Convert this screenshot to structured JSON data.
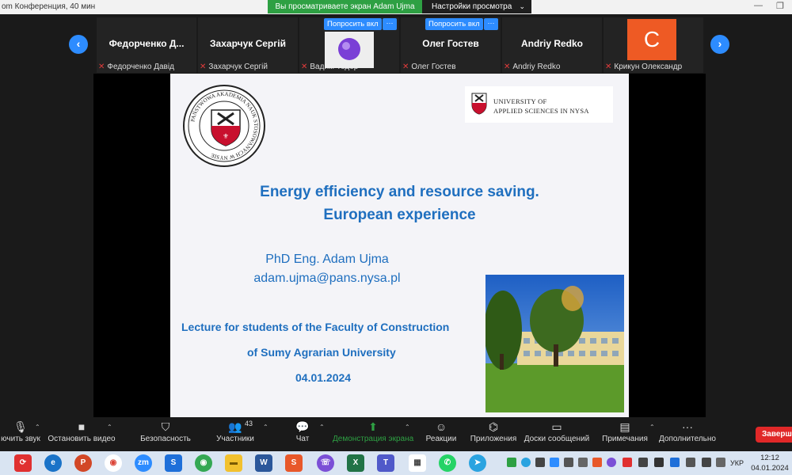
{
  "window": {
    "title": "om Конференция, 40 мин",
    "share_banner": "Вы просматриваете экран Adam Ujma",
    "view_options": "Настройки просмотра"
  },
  "participants": [
    {
      "display": "Федорченко Д...",
      "label": "Федорченко Давід"
    },
    {
      "display": "Захарчук Сергій",
      "label": "Захарчук Сергій"
    },
    {
      "display": "",
      "label": "Вадим Тодор",
      "ask": "Попросить вкл"
    },
    {
      "display": "Олег Гостев",
      "label": "Олег Гостев",
      "ask": "Попросить вкл"
    },
    {
      "display": "Andriy Redko",
      "label": "Andriy Redko"
    },
    {
      "display": "C",
      "label": "Крикун Олександр"
    }
  ],
  "slide": {
    "seal_text": "PAŃSTWOWA AKADEMIA NAUK STOSOWANYCH W NYSIE",
    "uni_line1": "UNIVERSITY OF",
    "uni_line2": "APPLIED SCIENCES IN NYSA",
    "title_line1": "Energy efficiency and resource saving.",
    "title_line2": "European experience",
    "author": "PhD Eng. Adam Ujma",
    "email": "adam.ujma@pans.nysa.pl",
    "lecture_line1": "Lecture for students of the Faculty of Construction",
    "lecture_line2": "of Sumy Agrarian University",
    "date": "04.01.2024"
  },
  "toolbar": {
    "unmute": "ючить звук",
    "stop_video": "Остановить видео",
    "security": "Безопасность",
    "participants": "Участники",
    "participants_count": "43",
    "chat": "Чат",
    "share_screen": "Демонстрация экрана",
    "reactions": "Реакции",
    "apps": "Приложения",
    "whiteboards": "Доски сообщений",
    "notes": "Примечания",
    "more": "Дополнительно",
    "end": "Заверши"
  },
  "taskbar": {
    "lang": "УКР",
    "time": "12:12",
    "date": "04.01.2024"
  },
  "colors": {
    "accent": "#2d8cff",
    "share_green": "#2ea043",
    "slide_blue": "#1f6fbf",
    "end_red": "#e02828"
  }
}
